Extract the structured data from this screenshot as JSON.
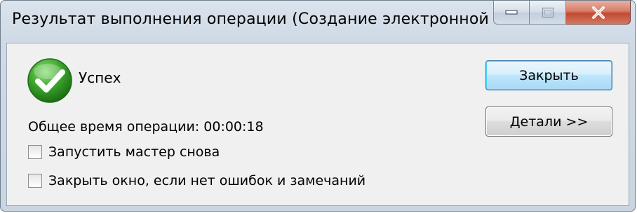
{
  "window": {
    "title": "Результат выполнения операции (Создание электронной ..."
  },
  "status": {
    "icon": "success-check-icon",
    "text": "Успех"
  },
  "time": {
    "label": "Общее время операции:",
    "value": "00:00:18"
  },
  "options": [
    {
      "label": "Запустить мастер снова",
      "checked": false
    },
    {
      "label": "Закрыть окно, если нет ошибок и замечаний",
      "checked": false
    }
  ],
  "buttons": {
    "close_label": "Закрыть",
    "details_label": "Детали >>"
  },
  "colors": {
    "success_green": "#3aa32a",
    "close_button_red": "#c24a31",
    "default_button_border": "#3c7fb1"
  }
}
